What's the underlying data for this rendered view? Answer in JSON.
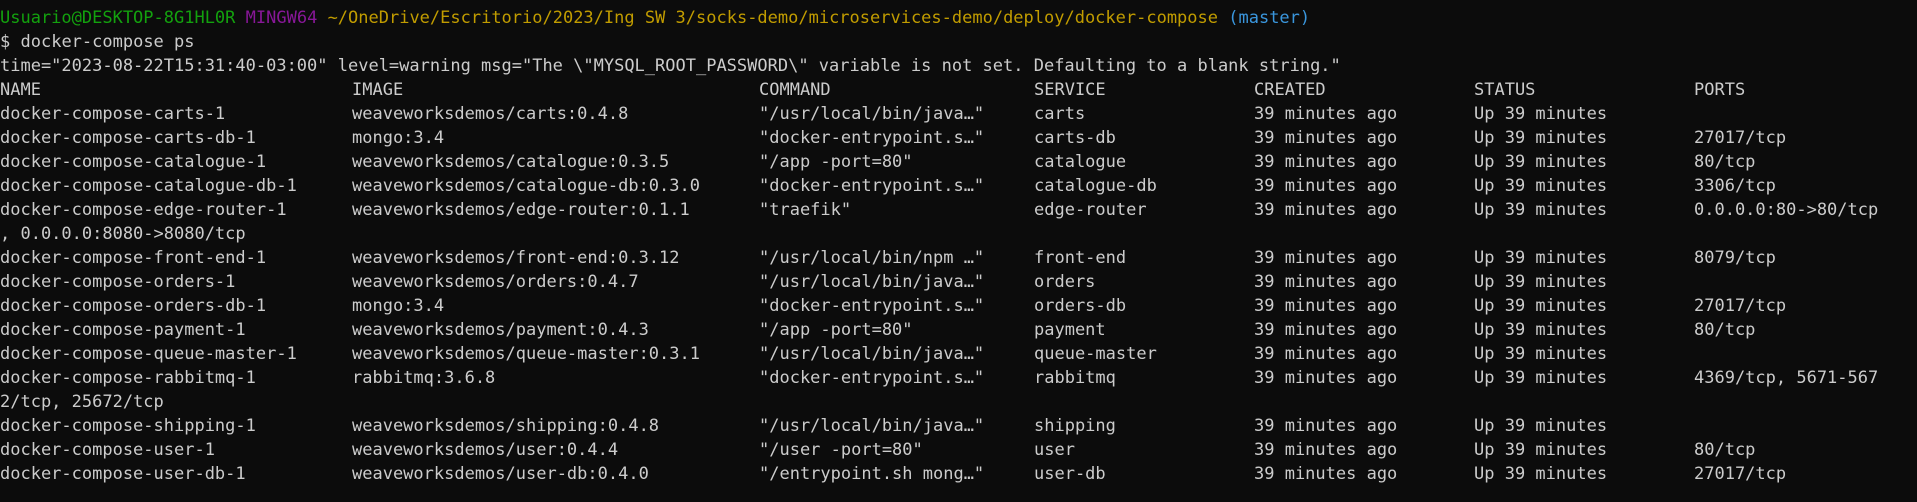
{
  "prompt": {
    "user_host": "Usuario@DESKTOP-8G1HL0R",
    "shell": "MINGW64",
    "path": "~/OneDrive/Escritorio/2023/Ing SW 3/socks-demo/microservices-demo/deploy/docker-compose",
    "branch": "(master)",
    "symbol": "$",
    "command": "docker-compose ps"
  },
  "warning": "time=\"2023-08-22T15:31:40-03:00\" level=warning msg=\"The \\\"MYSQL_ROOT_PASSWORD\\\" variable is not set. Defaulting to a blank string.\"",
  "table": {
    "headers": {
      "name": "NAME",
      "image": "IMAGE",
      "command": "COMMAND",
      "service": "SERVICE",
      "created": "CREATED",
      "status": "STATUS",
      "ports": "PORTS"
    },
    "rows": [
      {
        "name": "docker-compose-carts-1",
        "image": "weaveworksdemos/carts:0.4.8",
        "command": "\"/usr/local/bin/java…\"",
        "service": "carts",
        "created": "39 minutes ago",
        "status": "Up 39 minutes",
        "ports": ""
      },
      {
        "name": "docker-compose-carts-db-1",
        "image": "mongo:3.4",
        "command": "\"docker-entrypoint.s…\"",
        "service": "carts-db",
        "created": "39 minutes ago",
        "status": "Up 39 minutes",
        "ports": "27017/tcp"
      },
      {
        "name": "docker-compose-catalogue-1",
        "image": "weaveworksdemos/catalogue:0.3.5",
        "command": "\"/app -port=80\"",
        "service": "catalogue",
        "created": "39 minutes ago",
        "status": "Up 39 minutes",
        "ports": "80/tcp"
      },
      {
        "name": "docker-compose-catalogue-db-1",
        "image": "weaveworksdemos/catalogue-db:0.3.0",
        "command": "\"docker-entrypoint.s…\"",
        "service": "catalogue-db",
        "created": "39 minutes ago",
        "status": "Up 39 minutes",
        "ports": "3306/tcp"
      },
      {
        "name": "docker-compose-edge-router-1",
        "image": "weaveworksdemos/edge-router:0.1.1",
        "command": "\"traefik\"",
        "service": "edge-router",
        "created": "39 minutes ago",
        "status": "Up 39 minutes",
        "ports": "0.0.0.0:80->80/tcp",
        "ports_wrap": ", 0.0.0.0:8080->8080/tcp"
      },
      {
        "name": "docker-compose-front-end-1",
        "image": "weaveworksdemos/front-end:0.3.12",
        "command": "\"/usr/local/bin/npm …\"",
        "service": "front-end",
        "created": "39 minutes ago",
        "status": "Up 39 minutes",
        "ports": "8079/tcp"
      },
      {
        "name": "docker-compose-orders-1",
        "image": "weaveworksdemos/orders:0.4.7",
        "command": "\"/usr/local/bin/java…\"",
        "service": "orders",
        "created": "39 minutes ago",
        "status": "Up 39 minutes",
        "ports": ""
      },
      {
        "name": "docker-compose-orders-db-1",
        "image": "mongo:3.4",
        "command": "\"docker-entrypoint.s…\"",
        "service": "orders-db",
        "created": "39 minutes ago",
        "status": "Up 39 minutes",
        "ports": "27017/tcp"
      },
      {
        "name": "docker-compose-payment-1",
        "image": "weaveworksdemos/payment:0.4.3",
        "command": "\"/app -port=80\"",
        "service": "payment",
        "created": "39 minutes ago",
        "status": "Up 39 minutes",
        "ports": "80/tcp"
      },
      {
        "name": "docker-compose-queue-master-1",
        "image": "weaveworksdemos/queue-master:0.3.1",
        "command": "\"/usr/local/bin/java…\"",
        "service": "queue-master",
        "created": "39 minutes ago",
        "status": "Up 39 minutes",
        "ports": ""
      },
      {
        "name": "docker-compose-rabbitmq-1",
        "image": "rabbitmq:3.6.8",
        "command": "\"docker-entrypoint.s…\"",
        "service": "rabbitmq",
        "created": "39 minutes ago",
        "status": "Up 39 minutes",
        "ports": "4369/tcp, 5671-567",
        "ports_wrap": "2/tcp, 25672/tcp"
      },
      {
        "name": "docker-compose-shipping-1",
        "image": "weaveworksdemos/shipping:0.4.8",
        "command": "\"/usr/local/bin/java…\"",
        "service": "shipping",
        "created": "39 minutes ago",
        "status": "Up 39 minutes",
        "ports": ""
      },
      {
        "name": "docker-compose-user-1",
        "image": "weaveworksdemos/user:0.4.4",
        "command": "\"/user -port=80\"",
        "service": "user",
        "created": "39 minutes ago",
        "status": "Up 39 minutes",
        "ports": "80/tcp"
      },
      {
        "name": "docker-compose-user-db-1",
        "image": "weaveworksdemos/user-db:0.4.0",
        "command": "\"/entrypoint.sh mong…\"",
        "service": "user-db",
        "created": "39 minutes ago",
        "status": "Up 39 minutes",
        "ports": "27017/tcp"
      }
    ]
  },
  "colors": {
    "background": "#0c0c0c",
    "text": "#cccccc",
    "user": "#13a10e",
    "shell": "#881798",
    "path": "#c19c00",
    "branch": "#3a96dd"
  }
}
